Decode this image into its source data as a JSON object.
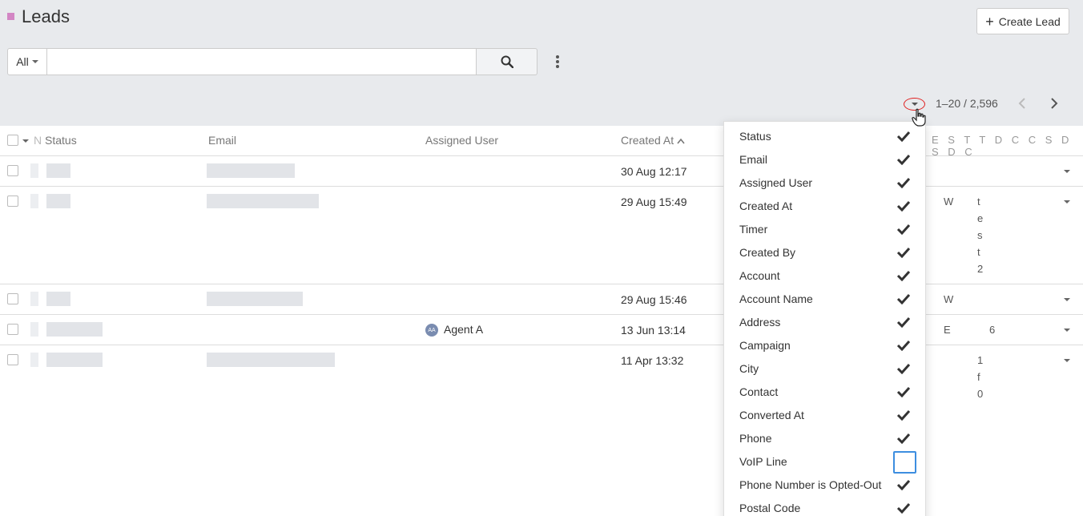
{
  "page": {
    "title": "Leads",
    "create_label": "Create Lead"
  },
  "search": {
    "filter_value": "All",
    "query": ""
  },
  "pagination": {
    "range": "1–20 / 2,596"
  },
  "table": {
    "headers": {
      "status": "Status",
      "email": "Email",
      "assigned_user": "Assigned User",
      "created_at": "Created At",
      "name_short": "N",
      "extra": "E S T T D C C S D S D C"
    },
    "rows": [
      {
        "created_at": "30 Aug 12:17",
        "assigned_user": "",
        "extra": []
      },
      {
        "created_at": "29 Aug 15:49",
        "assigned_user": "",
        "extra": [
          "W",
          "test2"
        ]
      },
      {
        "created_at": "29 Aug 15:46",
        "assigned_user": "",
        "extra": [
          "W"
        ]
      },
      {
        "created_at": "13 Jun 13:14",
        "assigned_user": "Agent A",
        "avatar_initials": "AA",
        "extra": [
          "E",
          "6"
        ]
      },
      {
        "created_at": "11 Apr 13:32",
        "assigned_user": "",
        "extra": [
          "1 f 0"
        ]
      }
    ]
  },
  "column_menu": {
    "items": [
      {
        "label": "Status",
        "checked": true
      },
      {
        "label": "Email",
        "checked": true
      },
      {
        "label": "Assigned User",
        "checked": true
      },
      {
        "label": "Created At",
        "checked": true
      },
      {
        "label": "Timer",
        "checked": true
      },
      {
        "label": "Created By",
        "checked": true
      },
      {
        "label": "Account",
        "checked": true
      },
      {
        "label": "Account Name",
        "checked": true
      },
      {
        "label": "Address",
        "checked": true
      },
      {
        "label": "Campaign",
        "checked": true
      },
      {
        "label": "City",
        "checked": true
      },
      {
        "label": "Contact",
        "checked": true
      },
      {
        "label": "Converted At",
        "checked": true
      },
      {
        "label": "Phone",
        "checked": true
      },
      {
        "label": "VoIP Line",
        "checked": false
      },
      {
        "label": "Phone Number is Opted-Out",
        "checked": true
      },
      {
        "label": "Postal Code",
        "checked": true
      }
    ]
  },
  "icons": {
    "search": "search-icon",
    "more": "kebab-icon",
    "prev": "chevron-left-icon",
    "next": "chevron-right-icon",
    "check": "check-icon"
  },
  "colors": {
    "accent_marker": "#d386c4",
    "focus_outline": "#3d8ee0",
    "annotation": "#e02020"
  }
}
